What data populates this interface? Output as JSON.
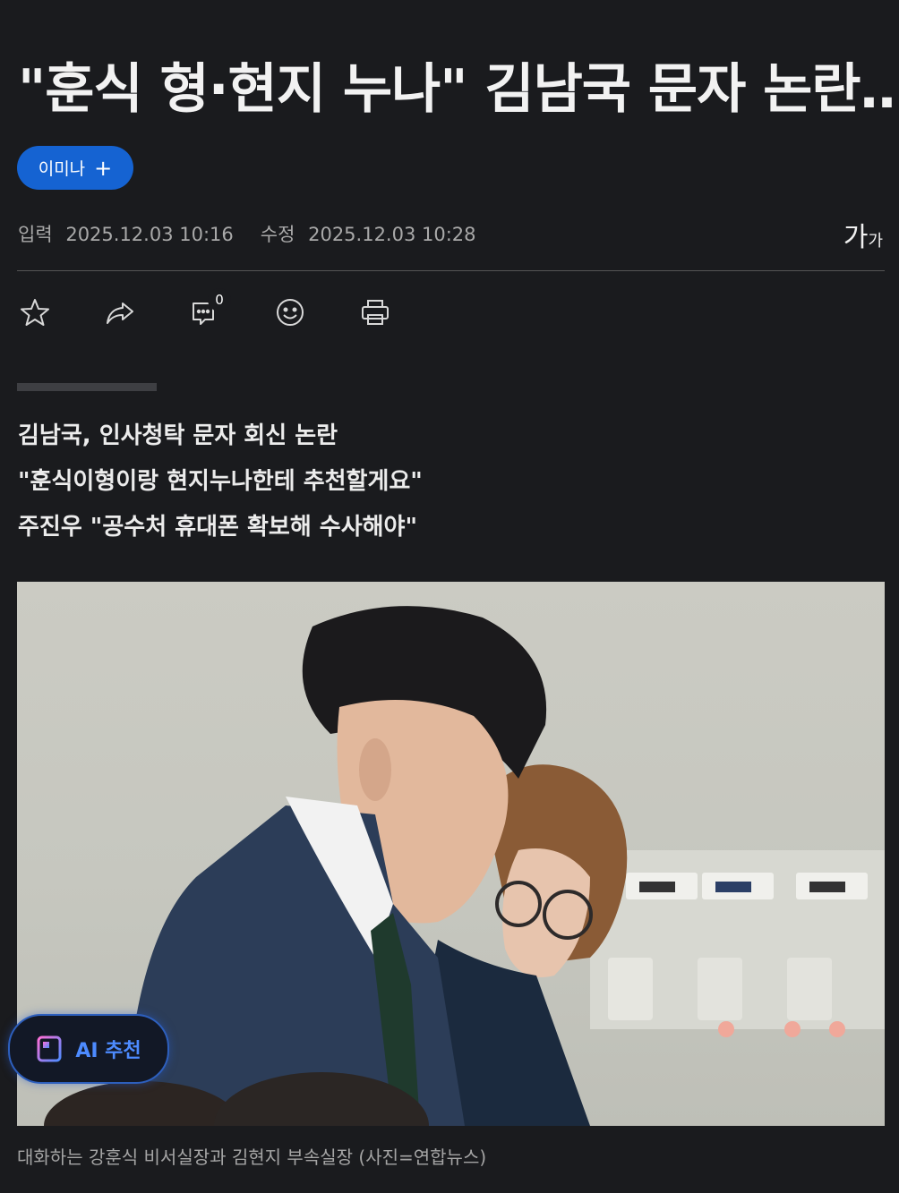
{
  "article": {
    "headline": "\"훈식 형·현지 누나\" 김남국 문자 논란…",
    "author": {
      "name": "이미나",
      "plus": "+"
    },
    "meta": {
      "input_label": "입력",
      "input_time": "2025.12.03 10:16",
      "modified_label": "수정",
      "modified_time": "2025.12.03 10:28"
    },
    "font_size": {
      "large": "가",
      "small": "가"
    },
    "toolbar": {
      "comment_count": "0",
      "icons": [
        "star-icon",
        "share-icon",
        "comment-icon",
        "emoji-icon",
        "print-icon"
      ]
    },
    "summary": [
      "김남국, 인사청탁 문자 회신 논란",
      "\"훈식이형이랑 현지누나한테 추천할게요\"",
      "주진우 \"공수처 휴대폰 확보해 수사해야\""
    ],
    "photo_caption": "대화하는 강훈식 비서실장과 김현지 부속실장 (사진=연합뉴스)"
  },
  "ai_button": {
    "label": "AI 추천",
    "icon": "document-icon"
  },
  "colors": {
    "background": "#1a1b1e",
    "accent": "#1563d2",
    "ai_blue": "#4d8bff"
  }
}
